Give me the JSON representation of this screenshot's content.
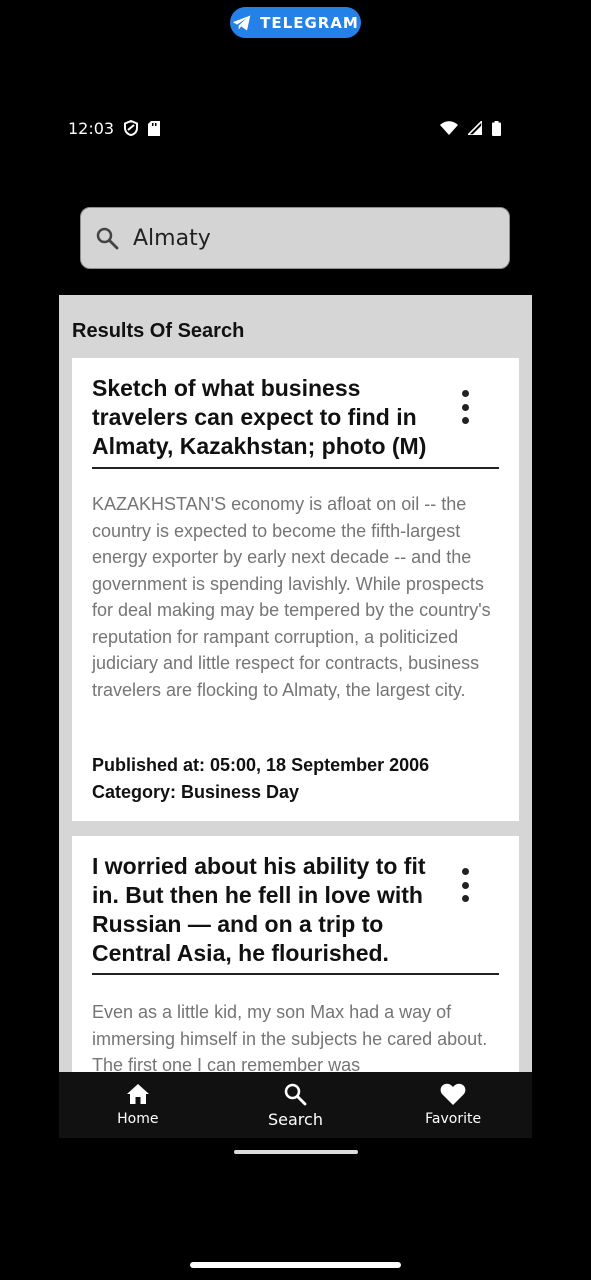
{
  "telegram": {
    "label": "TELEGRAM"
  },
  "status": {
    "time": "12:03"
  },
  "search": {
    "value": "Almaty"
  },
  "results": {
    "title": "Results Of Search",
    "articles": [
      {
        "title": "Sketch of what business travelers can expect to find in Almaty, Kazakhstan; photo (M)",
        "body": "KAZAKHSTAN'S economy is afloat on oil -- the country is expected to become the fifth-largest energy exporter by early next decade -- and the government is spending lavishly. While prospects for deal making may be tempered by the country's reputation for rampant corruption, a politicized judiciary and little respect for contracts, business travelers are flocking to Almaty, the largest city.",
        "published": "Published at: 05:00, 18 September 2006",
        "category": "Category: Business Day"
      },
      {
        "title": "I worried about his ability to fit in. But then he fell in love with Russian — and on a trip to Central Asia, he flourished.",
        "body": "Even as a little kid, my son Max had a way of immersing himself in the subjects he cared about. The first one I can remember was"
      }
    ]
  },
  "nav": {
    "home": "Home",
    "search": "Search",
    "favorite": "Favorite",
    "active": "search"
  },
  "icons": {
    "telegram": "telegram-icon",
    "search": "search-icon",
    "more": "more-vertical-icon",
    "home": "home-icon",
    "favorite": "heart-icon"
  },
  "colors": {
    "telegram_pill": "#2481e8",
    "panel": "#d6d6d6",
    "search_field": "#d4d4d4",
    "nav_bg": "#111111"
  }
}
